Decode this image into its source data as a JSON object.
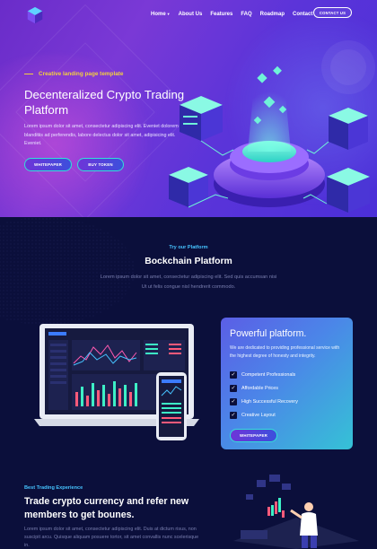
{
  "nav": {
    "items": [
      {
        "label": "Home",
        "has_dropdown": true
      },
      {
        "label": "About Us"
      },
      {
        "label": "Features"
      },
      {
        "label": "FAQ"
      },
      {
        "label": "Roadmap"
      },
      {
        "label": "Contact"
      }
    ],
    "cta_label": "CONTACT US"
  },
  "hero": {
    "tagline": "Creative landing page template",
    "title": "Decenteralized Crypto Trading Platform",
    "description": "Lorem ipsum dolor sit amet, consectetur adipiscing elit. Eveniet dolorem blanditiis ad perferendis, labore delectus dolor sit amet, adipisicing elit. Eveniet.",
    "primary_button": "WHITEPAPER",
    "secondary_button": "BUY TOKEN"
  },
  "platform": {
    "eyebrow": "Try our Platform",
    "title": "Bockchain Platform",
    "description": "Lorem ipsum dolor sit amet, consectetur adipiscing elit. Sed quis accumsan nisi Ut ut felis congue nisl hendrerit commodo.",
    "card": {
      "title": "Powerful platform.",
      "description": "We are dedicated to providing professional service with the highest degree of honesty and integrity.",
      "features": [
        "Competent Professionals",
        "Affordable Prices",
        "High Successful Recovery",
        "Creative Layout"
      ],
      "button": "WHITEPAPER"
    }
  },
  "trading": {
    "eyebrow": "Best Trading Experience",
    "title": "Trade crypto currency and refer new members to get bounes.",
    "description": "Lorem ipsum dolor sit amet, consectetur adipiscing elit. Duis at dictum risus, non suscipit arcu. Quisque aliquam posuere tortor, sit amet convallis nunc scelerisque in."
  },
  "colors": {
    "accent_yellow": "#f4d03f",
    "accent_cyan": "#46c3ff",
    "bg_dark": "#0b0f3b",
    "hero_purple": "#6a2cc9"
  }
}
